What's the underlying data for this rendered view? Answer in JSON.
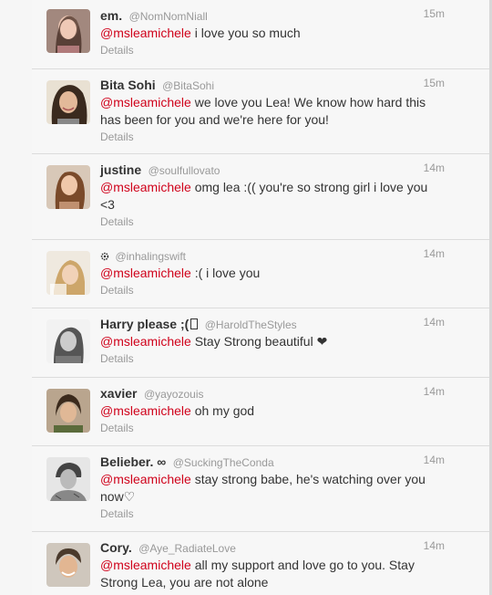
{
  "tweets": [
    {
      "name": "em.",
      "handle": "@NomNomNiall",
      "time": "15m",
      "mention": "@msleamichele",
      "text": " i love you so much",
      "details": "Details",
      "icon": "avatar-girl-dark-hair"
    },
    {
      "name": "Bita Sohi",
      "handle": "@BitaSohi",
      "time": "15m",
      "mention": "@msleamichele",
      "text": " we love you Lea! We know how hard this has been for you and we're here for you!",
      "details": "Details",
      "icon": "avatar-woman-smiling"
    },
    {
      "name": "justine",
      "handle": "@soulfullovato",
      "time": "14m",
      "mention": "@msleamichele",
      "text": " omg lea :(( you're so strong girl i love you <3",
      "details": "Details",
      "icon": "avatar-girl-brown-hair"
    },
    {
      "name": "",
      "handle": "@inhalingswift",
      "time": "14m",
      "mention": "@msleamichele",
      "text": " :( i love you",
      "details": "Details",
      "icon": "avatar-blonde-photo"
    },
    {
      "name": "Harry please ;(",
      "handle": "@HaroldTheStyles",
      "time": "14m",
      "mention": "@msleamichele",
      "text": " Stay Strong beautiful ❤",
      "details": "Details",
      "icon": "avatar-bw-man"
    },
    {
      "name": "xavier",
      "handle": "@yayozouis",
      "time": "14m",
      "mention": "@msleamichele",
      "text": " oh my god",
      "details": "Details",
      "icon": "avatar-young-man"
    },
    {
      "name": "Belieber. ∞",
      "handle": "@SuckingTheConda",
      "time": "14m",
      "mention": "@msleamichele",
      "text": " stay strong babe, he's watching over you now♡",
      "details": "Details",
      "icon": "avatar-bw-tattoo"
    },
    {
      "name": "Cory.",
      "handle": "@Aye_RadiateLove",
      "time": "14m",
      "mention": "@msleamichele",
      "text": " all my support and love go to you. Stay Strong Lea, you are not alone",
      "details": "",
      "icon": "avatar-man-smiling"
    }
  ],
  "colors": {
    "mention": "#d0021b",
    "name": "#333333",
    "meta": "#999999",
    "background": "#f7f7f7"
  }
}
